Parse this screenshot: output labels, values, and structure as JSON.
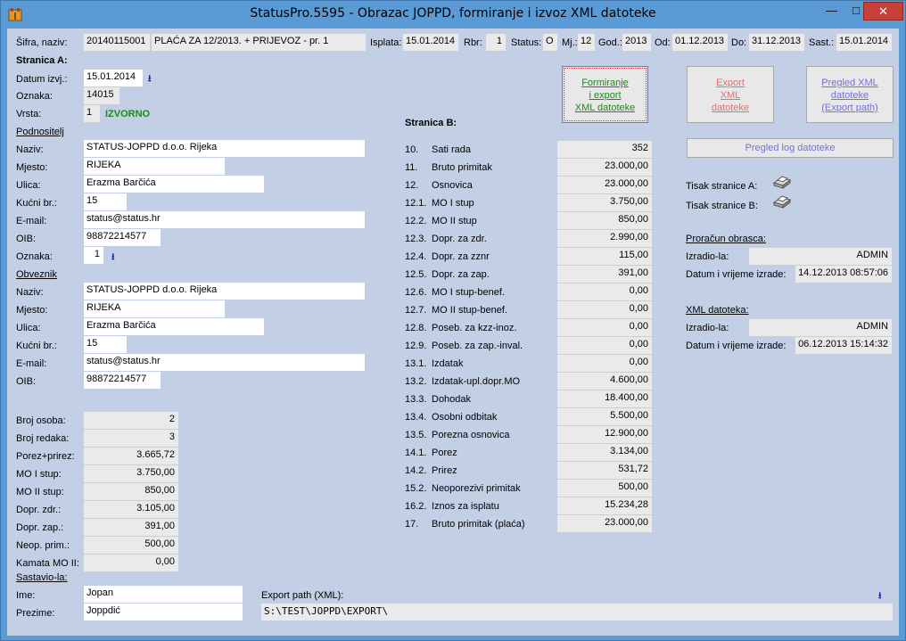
{
  "window": {
    "title": "StatusPro.5595 - Obrazac JOPPD, formiranje i izvoz XML datoteke"
  },
  "header": {
    "sifra_label": "Šifra, naziv:",
    "sifra": "20140115001",
    "naziv": "PLAĆA ZA 12/2013. + PRIJEVOZ - pr. 1",
    "isplata_label": "Isplata:",
    "isplata": "15.01.2014",
    "rbr_label": "Rbr:",
    "rbr": "1",
    "status_label": "Status:",
    "status": "O",
    "mj_label": "Mj.:",
    "mj": "12",
    "god_label": "God.:",
    "god": "2013",
    "od_label": "Od:",
    "od": "01.12.2013",
    "do_label": "Do:",
    "do": "31.12.2013",
    "sast_label": "Sast.:",
    "sast": "15.01.2014"
  },
  "stranica_a": {
    "title": "Stranica A:",
    "datum_label": "Datum izvj.:",
    "datum": "15.01.2014",
    "oznaka_label": "Oznaka:",
    "oznaka": "14015",
    "vrsta_label": "Vrsta:",
    "vrsta": "1",
    "vrsta_text": "IZVORNO",
    "podnositelj": {
      "title": "Podnositelj",
      "naziv_label": "Naziv:",
      "naziv": "STATUS-JOPPD d.o.o. Rijeka",
      "mjesto_label": "Mjesto:",
      "mjesto": "RIJEKA",
      "ulica_label": "Ulica:",
      "ulica": "Erazma Barčića",
      "kbr_label": "Kućni br.:",
      "kbr": "15",
      "email_label": "E-mail:",
      "email": "status@status.hr",
      "oib_label": "OIB:",
      "oib": "98872214577",
      "oznaka_label": "Oznaka:",
      "oznaka": "1"
    },
    "obveznik": {
      "title": "Obveznik",
      "naziv_label": "Naziv:",
      "naziv": "STATUS-JOPPD d.o.o. Rijeka",
      "mjesto_label": "Mjesto:",
      "mjesto": "RIJEKA",
      "ulica_label": "Ulica:",
      "ulica": "Erazma Barčića",
      "kbr_label": "Kućni br.:",
      "kbr": "15",
      "email_label": "E-mail:",
      "email": "status@status.hr",
      "oib_label": "OIB:",
      "oib": "98872214577"
    },
    "totals": [
      {
        "label": "Broj osoba:",
        "value": "2"
      },
      {
        "label": "Broj redaka:",
        "value": "3"
      },
      {
        "label": "Porez+prirez:",
        "value": "3.665,72"
      },
      {
        "label": "MO I stup:",
        "value": "3.750,00"
      },
      {
        "label": "MO II stup:",
        "value": "850,00"
      },
      {
        "label": "Dopr. zdr.:",
        "value": "3.105,00"
      },
      {
        "label": "Dopr. zap.:",
        "value": "391,00"
      },
      {
        "label": "Neop. prim.:",
        "value": "500,00"
      },
      {
        "label": "Kamata MO II:",
        "value": "0,00"
      }
    ],
    "sastavio": {
      "title": "Sastavio-la:",
      "ime_label": "Ime:",
      "ime": "Jopan",
      "prezime_label": "Prezime:",
      "prezime": "Joppdić"
    }
  },
  "stranica_b": {
    "title": "Stranica B:",
    "rows": [
      {
        "code": "10.",
        "label": "Sati rada",
        "value": "352"
      },
      {
        "code": "11.",
        "label": "Bruto primitak",
        "value": "23.000,00"
      },
      {
        "code": "12.",
        "label": "Osnovica",
        "value": "23.000,00"
      },
      {
        "code": "12.1.",
        "label": "MO I stup",
        "value": "3.750,00"
      },
      {
        "code": "12.2.",
        "label": "MO II stup",
        "value": "850,00"
      },
      {
        "code": "12.3.",
        "label": "Dopr. za zdr.",
        "value": "2.990,00"
      },
      {
        "code": "12.4.",
        "label": "Dopr. za zznr",
        "value": "115,00"
      },
      {
        "code": "12.5.",
        "label": "Dopr. za zap.",
        "value": "391,00"
      },
      {
        "code": "12.6.",
        "label": "MO I stup-benef.",
        "value": "0,00"
      },
      {
        "code": "12.7.",
        "label": "MO II stup-benef.",
        "value": "0,00"
      },
      {
        "code": "12.8.",
        "label": "Poseb. za kzz-inoz.",
        "value": "0,00"
      },
      {
        "code": "12.9.",
        "label": "Poseb. za zap.-inval.",
        "value": "0,00"
      },
      {
        "code": "13.1.",
        "label": "Izdatak",
        "value": "0,00"
      },
      {
        "code": "13.2.",
        "label": "Izdatak-upl.dopr.MO",
        "value": "4.600,00"
      },
      {
        "code": "13.3.",
        "label": "Dohodak",
        "value": "18.400,00"
      },
      {
        "code": "13.4.",
        "label": "Osobni odbitak",
        "value": "5.500,00"
      },
      {
        "code": "13.5.",
        "label": "Porezna osnovica",
        "value": "12.900,00"
      },
      {
        "code": "14.1.",
        "label": "Porez",
        "value": "3.134,00"
      },
      {
        "code": "14.2.",
        "label": "Prirez",
        "value": "531,72"
      },
      {
        "code": "15.2.",
        "label": "Neoporezivi primitak",
        "value": "500,00"
      },
      {
        "code": "16.2.",
        "label": "Iznos za isplatu",
        "value": "15.234,28"
      },
      {
        "code": "17.",
        "label": "Bruto primitak (plaća)",
        "value": "23.000,00"
      }
    ]
  },
  "buttons": {
    "formiranje": [
      "Formiranje",
      "i export",
      "XML datoteke"
    ],
    "export": [
      "Export",
      "XML",
      "datoteke"
    ],
    "pregled": [
      "Pregled XML",
      "datoteke",
      "(Export path)"
    ],
    "pregled_log": "Pregled log datoteke"
  },
  "tisak": {
    "a_label": "Tisak stranice A:",
    "b_label": "Tisak stranice B:"
  },
  "proracun": {
    "title": "Proračun obrasca:",
    "izradio_label": "Izradio-la:",
    "izradio": "ADMIN",
    "datum_label": "Datum i vrijeme izrade:",
    "datum": "14.12.2013 08:57:06"
  },
  "xml": {
    "title": "XML datoteka:",
    "izradio_label": "Izradio-la:",
    "izradio": "ADMIN",
    "datum_label": "Datum i vrijeme izrade:",
    "datum": "06.12.2013 15:14:32"
  },
  "export_path": {
    "label": "Export path (XML):",
    "value": "S:\\TEST\\JOPPD\\EXPORT\\"
  }
}
